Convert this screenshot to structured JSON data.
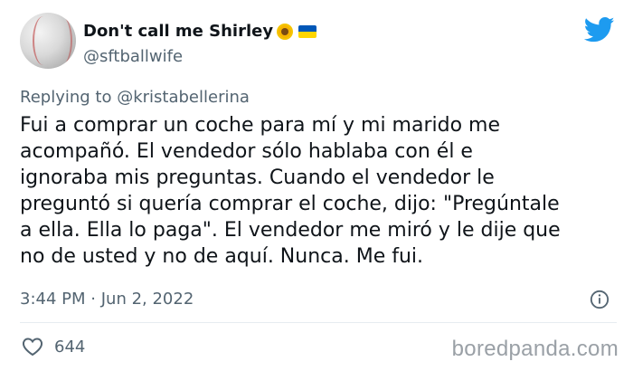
{
  "tweet": {
    "display_name": "Don't call me Shirley",
    "handle": "@sftballwife",
    "icons": {
      "avatar": "softball-avatar",
      "emoji_1": "sunflower-icon",
      "emoji_2": "ukraine-flag-icon",
      "brand": "twitter-bird-icon",
      "info": "info-icon",
      "like": "heart-icon"
    },
    "replying_prefix": "Replying to",
    "replying_to": "@kristabellerina",
    "text_lines": [
      "Fui a comprar un coche para mí y mi marido me",
      "acompañó. El vendedor sólo hablaba con él e",
      "ignoraba mis preguntas. Cuando el vendedor le",
      "preguntó si quería comprar el coche, dijo: \"Pregúntale",
      "a ella. Ella lo paga\". El vendedor me miró y le dije que",
      "no de usted y no de aquí. Nunca. Me fui."
    ],
    "time": "3:44 PM",
    "separator": "·",
    "date": "Jun 2, 2022",
    "like_count": "644"
  },
  "watermark": "boredpanda.com",
  "colors": {
    "twitter_blue": "#1d9bf0",
    "text_primary": "#0f1419",
    "text_secondary": "#536471",
    "flag_blue": "#0057b7",
    "flag_yellow": "#ffd500"
  }
}
